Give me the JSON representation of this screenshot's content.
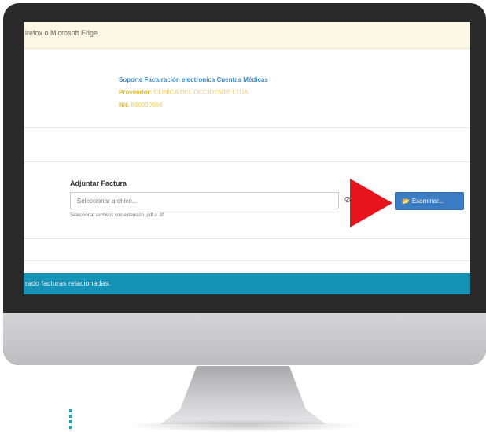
{
  "browser_notice": "irefox o Microsoft Edge",
  "info": {
    "title": "Soporte Facturación electronica Cuentas Médicas",
    "provider_label": "Proveedor:",
    "provider_value": "CLINICA DEL OCCIDENTE LTDA",
    "nit_label": "Nit:",
    "nit_value": "860090566"
  },
  "upload": {
    "label": "Adjuntar Factura",
    "placeholder": "Seleccionar archivo...",
    "browse_label": "Examinar...",
    "help_text": "Seleccionar archivos con extensión .pdf o .tif"
  },
  "footer_text": "rado facturas relacionadas.",
  "colors": {
    "accent_blue": "#3b7dc4",
    "footer_bar": "#1593b7",
    "pointer_arrow": "#e8141b",
    "provider_yellow": "#e9b622"
  },
  "icons": {
    "clear": "ban-icon",
    "browse": "folder-open-icon",
    "pointer": "red-arrow-icon"
  }
}
